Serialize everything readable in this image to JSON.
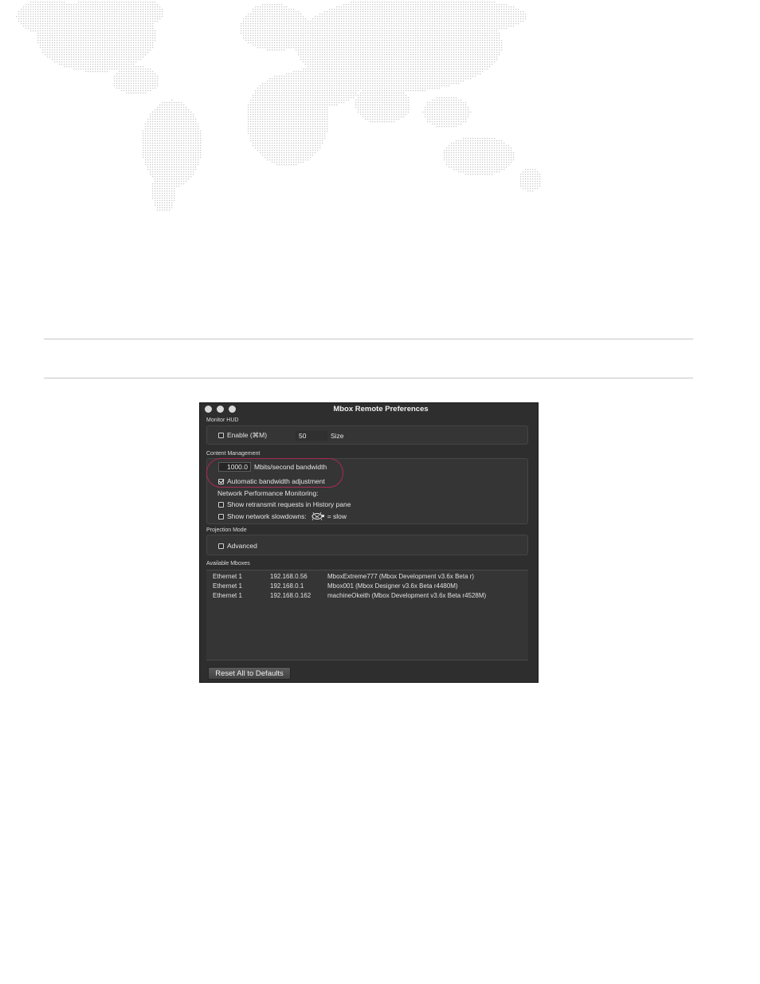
{
  "window": {
    "title": "Mbox Remote Preferences",
    "traffic_lights": [
      "close",
      "minimize",
      "zoom"
    ]
  },
  "monitor_hud": {
    "section_label": "Monitor HUD",
    "enable_label": "Enable (⌘M)",
    "enable_checked": false,
    "size_value": "50",
    "size_label": "Size"
  },
  "content_management": {
    "section_label": "Content Management",
    "bandwidth_value": "1000.0",
    "bandwidth_unit": "Mbits/second bandwidth",
    "auto_bandwidth_label": "Automatic bandwidth adjustment",
    "auto_bandwidth_checked": true,
    "network_heading": "Network Performance Monitoring:",
    "retransmit_label": "Show retransmit requests in History pane",
    "retransmit_checked": false,
    "slowdowns_label": "Show network slowdowns:",
    "slowdowns_icon": "turtle-icon",
    "slowdowns_suffix": "= slow",
    "slowdowns_checked": false
  },
  "projection_mode": {
    "section_label": "Projection Mode",
    "advanced_label": "Advanced",
    "advanced_checked": false
  },
  "available_mboxes": {
    "section_label": "Available Mboxes",
    "rows": [
      {
        "interface": "Ethernet 1",
        "ip": "192.168.0.56",
        "name": "MboxExtreme777 (Mbox Development v3.6x Beta r)"
      },
      {
        "interface": "Ethernet 1",
        "ip": "192.168.0.1",
        "name": "Mbox001 (Mbox Designer v3.6x Beta r4480M)"
      },
      {
        "interface": "Ethernet 1",
        "ip": "192.168.0.162",
        "name": "machineOkeith (Mbox Development v3.6x Beta r4528M)"
      }
    ]
  },
  "footer": {
    "reset_label": "Reset All to Defaults"
  },
  "colors": {
    "window_bg": "#2e2e2e",
    "highlight_oval": "#a82a55",
    "map_dot": "#c9c9c9"
  }
}
